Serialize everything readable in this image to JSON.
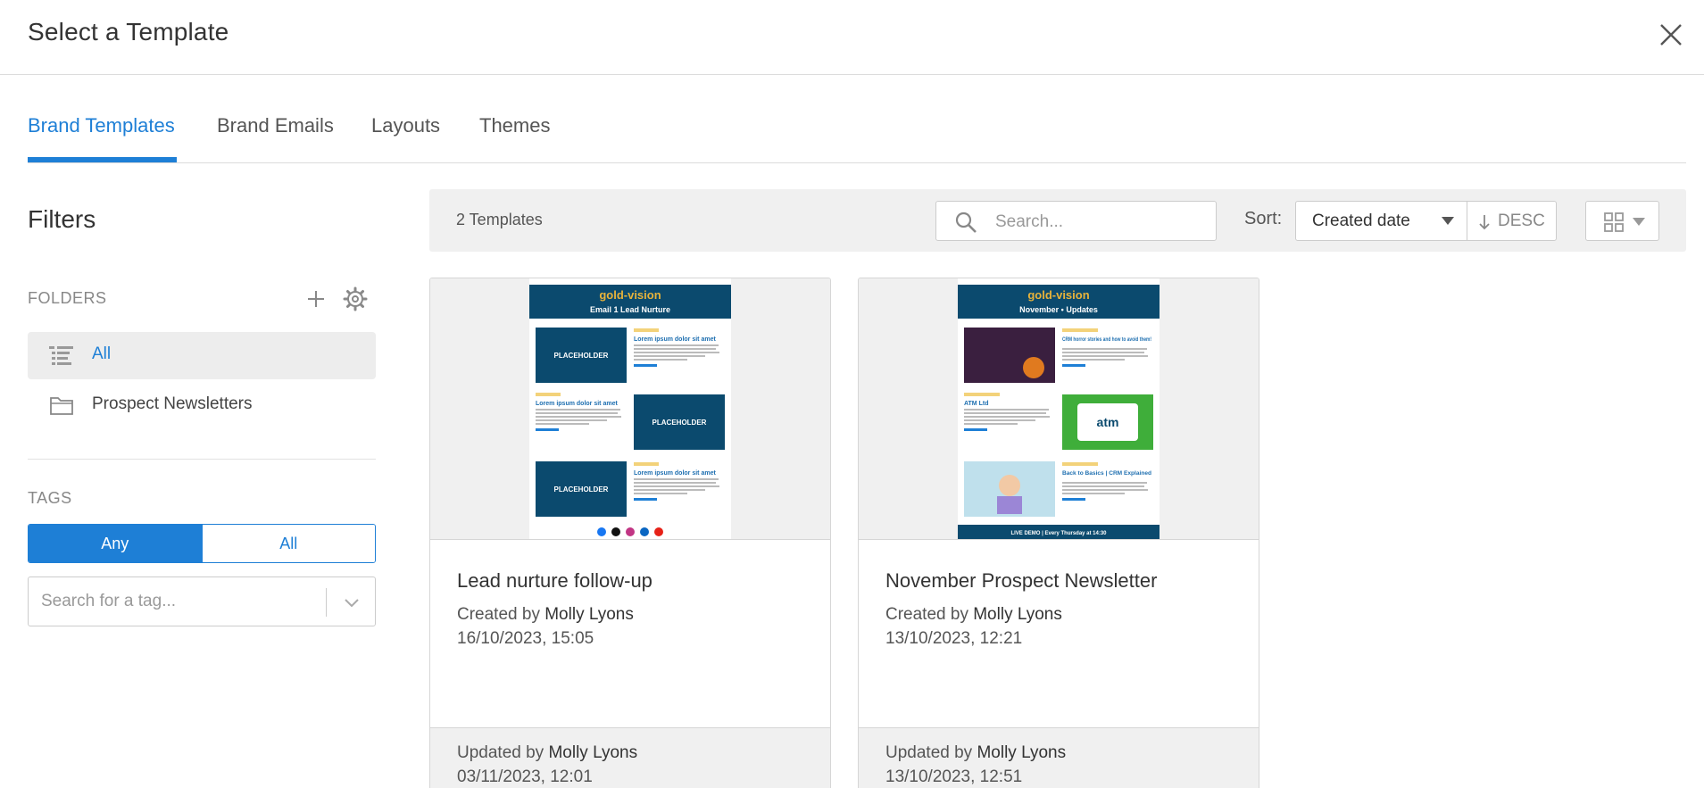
{
  "modal": {
    "title": "Select a Template"
  },
  "tabs": [
    {
      "label": "Brand Templates",
      "active": true
    },
    {
      "label": "Brand Emails",
      "active": false
    },
    {
      "label": "Layouts",
      "active": false
    },
    {
      "label": "Themes",
      "active": false
    }
  ],
  "filters": {
    "title": "Filters",
    "folders_label": "FOLDERS",
    "folders": [
      {
        "label": "All",
        "active": true,
        "icon": "list-icon"
      },
      {
        "label": "Prospect Newsletters",
        "active": false,
        "icon": "folder-icon"
      }
    ],
    "tags_label": "TAGS",
    "tag_mode": {
      "any": "Any",
      "all": "All",
      "selected": "Any"
    },
    "tag_search_placeholder": "Search for a tag..."
  },
  "toolbar": {
    "count": "2 Templates",
    "search_placeholder": "Search...",
    "sort_label": "Sort:",
    "sort_value": "Created date",
    "sort_direction": "DESC"
  },
  "templates": [
    {
      "name": "Lead nurture follow-up",
      "created_prefix": "Created by",
      "created_by": "Molly Lyons",
      "created_date": "16/10/2023, 15:05",
      "updated_prefix": "Updated by",
      "updated_by": "Molly Lyons",
      "updated_date": "03/11/2023, 12:01",
      "preview": {
        "brand": "gold-vision",
        "subtitle": "Email 1 Lead Nurture",
        "placeholder": "PLACEHOLDER",
        "heading": "Lorem ipsum dolor sit amet"
      }
    },
    {
      "name": "November Prospect Newsletter",
      "created_prefix": "Created by",
      "created_by": "Molly Lyons",
      "created_date": "13/10/2023, 12:21",
      "updated_prefix": "Updated by",
      "updated_by": "Molly Lyons",
      "updated_date": "13/10/2023, 12:51",
      "preview": {
        "brand": "gold-vision",
        "subtitle": "November • Updates",
        "article1": "CRM horror stories and how to avoid them!",
        "article2": "ATM Ltd",
        "logo": "atm",
        "article3": "Back to Basics | CRM Explained",
        "footer": "LIVE DEMO | Every Thursday at 14:30"
      }
    }
  ],
  "colors": {
    "accent": "#1e7fd6",
    "email_header": "#0b4a6e",
    "toolbar_bg": "#f0f0f0"
  }
}
